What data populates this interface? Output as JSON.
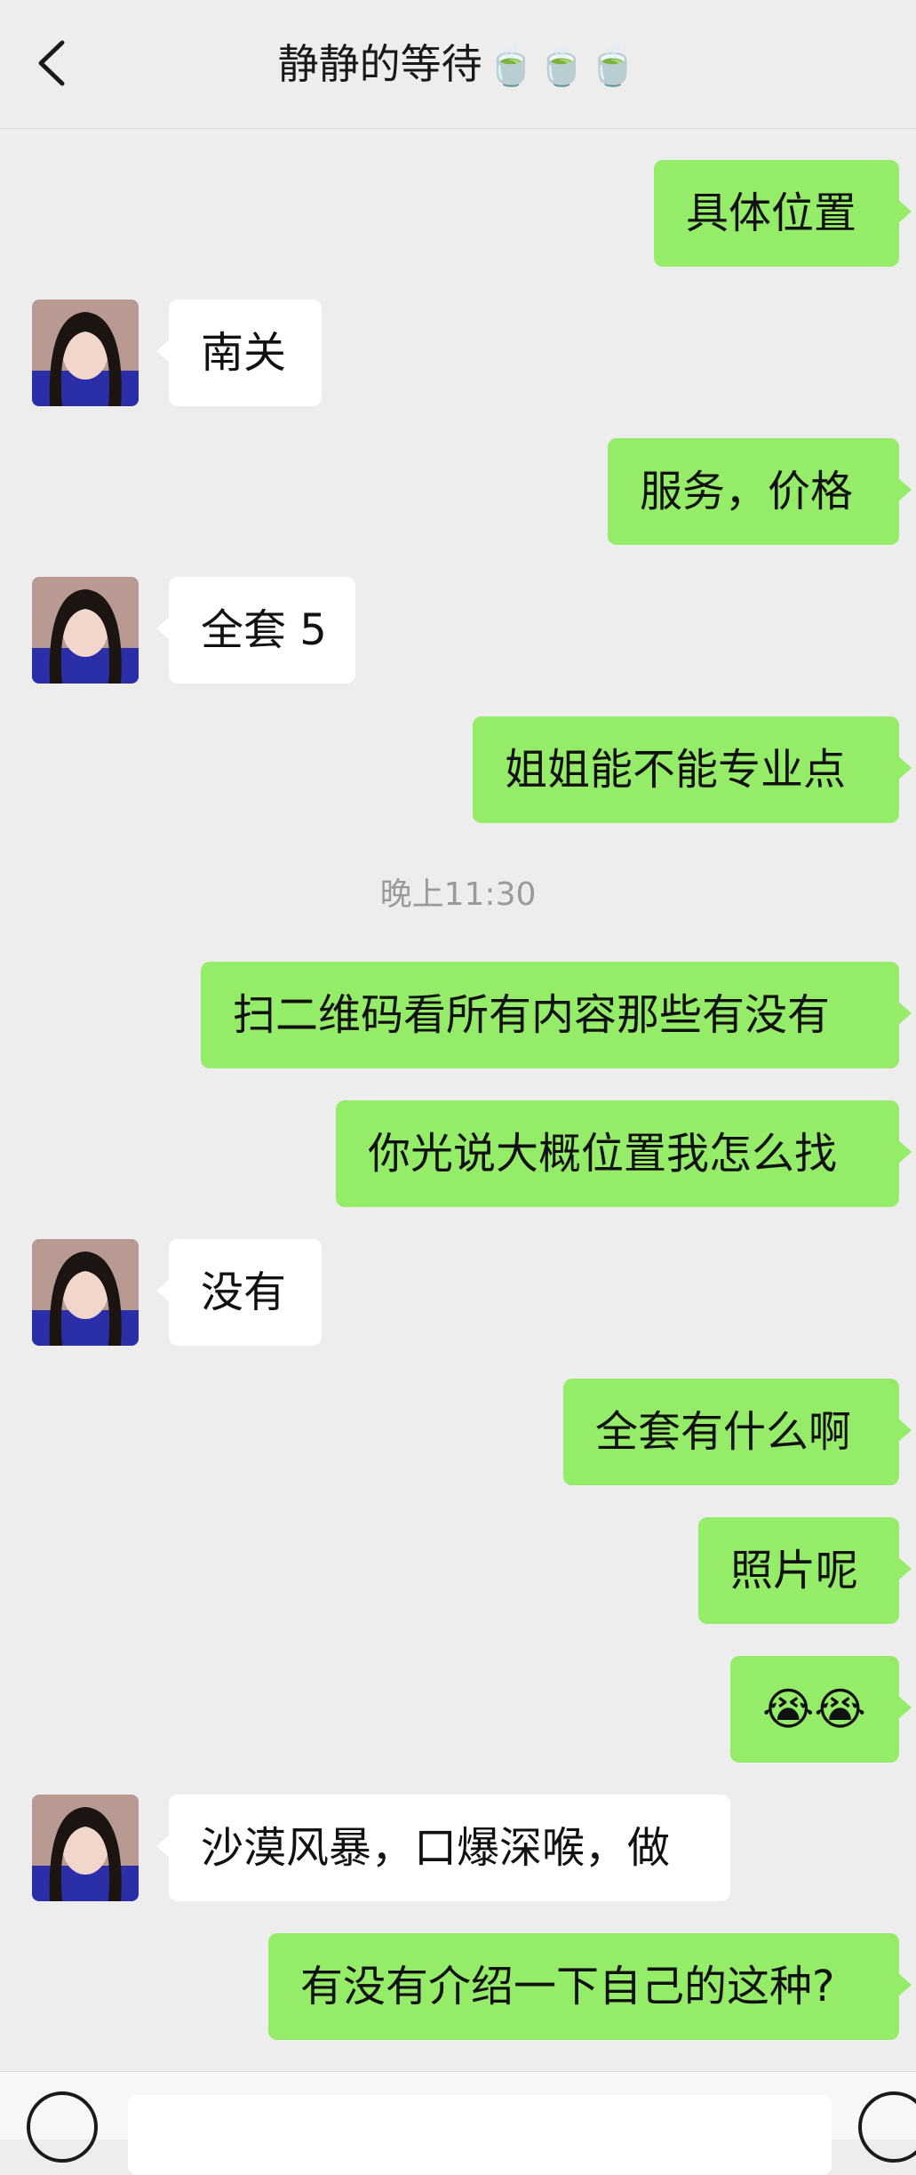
{
  "header": {
    "title": "静静的等待",
    "title_emoji": "🍵🍵🍵"
  },
  "messages": [
    {
      "side": "out",
      "text": "具体位置"
    },
    {
      "side": "in",
      "text": "南关"
    },
    {
      "side": "out",
      "text": "服务，价格"
    },
    {
      "side": "in",
      "text": "全套 5"
    },
    {
      "side": "out",
      "text": "姐姐能不能专业点"
    },
    {
      "side": "out",
      "text": "扫二维码看所有内容那些有没有"
    },
    {
      "side": "out",
      "text": "你光说大概位置我怎么找"
    },
    {
      "side": "in",
      "text": "没有"
    },
    {
      "side": "out",
      "text": "全套有什么啊"
    },
    {
      "side": "out",
      "text": "照片呢"
    },
    {
      "side": "out",
      "text": "😭😭"
    },
    {
      "side": "in",
      "text": "沙漠风暴，口爆深喉，做"
    },
    {
      "side": "out",
      "text": "有没有介绍一下自己的这种?"
    }
  ],
  "timestamp": "晚上11:30",
  "colors": {
    "outgoing_bubble": "#95ec69",
    "incoming_bubble": "#ffffff",
    "background": "#ededed"
  },
  "icons": {
    "back": "chevron-left-icon",
    "voice": "voice-icon",
    "emoji": "emoji-icon"
  }
}
